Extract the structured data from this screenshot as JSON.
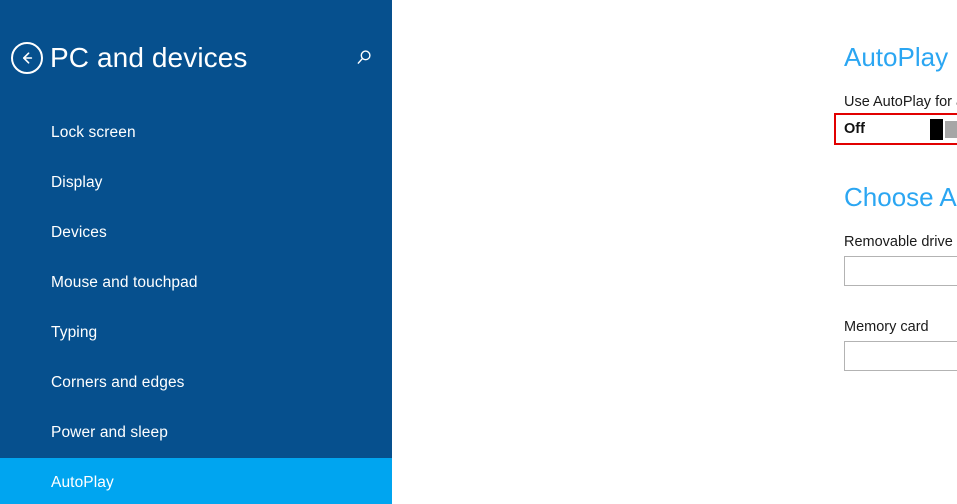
{
  "sidebar": {
    "back_icon": "back-arrow-icon",
    "title": "PC and devices",
    "search_icon": "search-icon",
    "items": [
      {
        "label": "Lock screen",
        "selected": false
      },
      {
        "label": "Display",
        "selected": false
      },
      {
        "label": "Devices",
        "selected": false
      },
      {
        "label": "Mouse and touchpad",
        "selected": false
      },
      {
        "label": "Typing",
        "selected": false
      },
      {
        "label": "Corners and edges",
        "selected": false
      },
      {
        "label": "Power and sleep",
        "selected": false
      },
      {
        "label": "AutoPlay",
        "selected": true
      }
    ],
    "background_color": "#06508E",
    "selected_color": "#00A5F0"
  },
  "content": {
    "heading_autoplay": "AutoPlay",
    "toggle": {
      "label": "Use AutoPlay for all media and devices",
      "state": "Off",
      "annotation_color": "#E10000"
    },
    "heading_defaults": "Choose AutoPlay defaults",
    "removable_drive": {
      "label": "Removable drive",
      "value": "",
      "chevron_icon": "chevron-down-icon"
    },
    "memory_card": {
      "label": "Memory card",
      "value": "",
      "chevron_icon": "chevron-down-icon"
    },
    "heading_color": "#2BA6F2"
  }
}
